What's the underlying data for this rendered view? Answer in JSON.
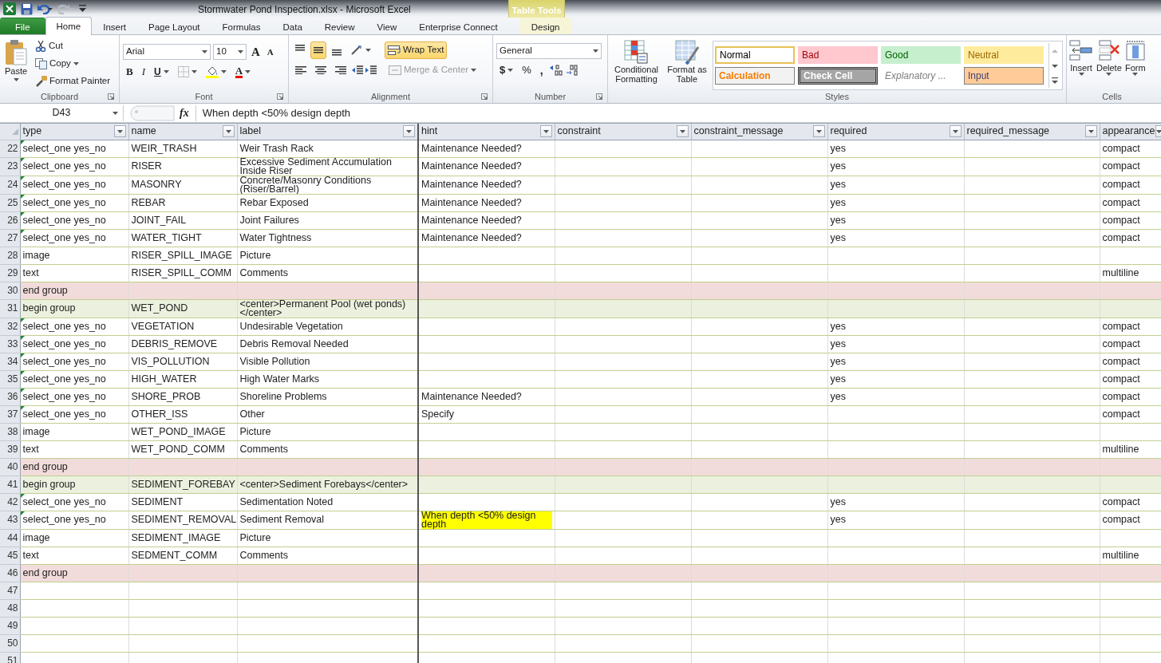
{
  "window": {
    "title": "Stormwater Pond Inspection.xlsx  -  Microsoft Excel"
  },
  "contextual_group": {
    "label": "Table Tools"
  },
  "tabs": [
    {
      "label": "File",
      "kind": "file",
      "selected": false
    },
    {
      "label": "Home",
      "kind": "tab",
      "selected": true
    },
    {
      "label": "Insert",
      "kind": "tab",
      "selected": false
    },
    {
      "label": "Page Layout",
      "kind": "tab",
      "selected": false
    },
    {
      "label": "Formulas",
      "kind": "tab",
      "selected": false
    },
    {
      "label": "Data",
      "kind": "tab",
      "selected": false
    },
    {
      "label": "Review",
      "kind": "tab",
      "selected": false
    },
    {
      "label": "View",
      "kind": "tab",
      "selected": false
    },
    {
      "label": "Enterprise Connect",
      "kind": "tab",
      "selected": false
    },
    {
      "label": "Design",
      "kind": "context",
      "selected": false
    }
  ],
  "clipboard": {
    "label": "Clipboard",
    "paste": "Paste",
    "cut": "Cut",
    "copy": "Copy",
    "format_painter": "Format Painter"
  },
  "font": {
    "label": "Font",
    "font_name": "Arial",
    "font_size": "10",
    "grow": "A",
    "shrink": "A",
    "bold": "B",
    "italic": "I",
    "underline": "U",
    "font_color": "A"
  },
  "alignment": {
    "label": "Alignment",
    "vertical": [
      {
        "kind": "top",
        "on": false
      },
      {
        "kind": "middle",
        "on": true
      },
      {
        "kind": "bottom",
        "on": false
      }
    ],
    "horizontal": [
      {
        "kind": "left",
        "on": false
      },
      {
        "kind": "center",
        "on": false
      },
      {
        "kind": "right",
        "on": false
      }
    ],
    "wrap_text": {
      "label": "Wrap Text",
      "on": true
    },
    "merge_center": {
      "label": "Merge & Center",
      "disabled": true
    }
  },
  "number": {
    "label": "Number",
    "format": "General",
    "currency": "$",
    "percent": "%",
    "comma": ","
  },
  "styles": {
    "label": "Styles",
    "conditional_formatting": "Conditional Formatting",
    "format_as_table": "Format as Table",
    "gallery": [
      {
        "label": "Normal",
        "kind": "normal",
        "selected": true
      },
      {
        "label": "Bad",
        "kind": "bad",
        "selected": false
      },
      {
        "label": "Good",
        "kind": "good",
        "selected": false
      },
      {
        "label": "Neutral",
        "kind": "neutral",
        "selected": false
      },
      {
        "label": "Calculation",
        "kind": "calculation",
        "selected": false
      },
      {
        "label": "Check Cell",
        "kind": "check",
        "selected": false
      },
      {
        "label": "Explanatory ...",
        "kind": "explanatory",
        "selected": false
      },
      {
        "label": "Input",
        "kind": "input",
        "selected": false
      }
    ]
  },
  "cells_group": {
    "label": "Cells",
    "insert": "Insert",
    "delete": "Delete",
    "format": "Form"
  },
  "formula_bar": {
    "name_box": "D43",
    "function_label": "fx",
    "formula": "When depth <50% design depth"
  },
  "table": {
    "columns": [
      "type",
      "name",
      "label",
      "hint",
      "constraint",
      "constraint_message",
      "required",
      "required_message",
      "appearance"
    ],
    "rows": [
      {
        "number": "22",
        "kind": "question",
        "flag": true,
        "highlighted": false,
        "cells": [
          "select_one yes_no",
          "WEIR_TRASH",
          "Weir Trash Rack",
          "Maintenance Needed?",
          null,
          null,
          "yes",
          null,
          "compact"
        ]
      },
      {
        "number": "23",
        "kind": "question",
        "flag": true,
        "highlighted": false,
        "cells": [
          "select_one yes_no",
          "RISER",
          "Excessive Sediment Accumulation Inside Riser",
          "Maintenance Needed?",
          null,
          null,
          "yes",
          null,
          "compact"
        ]
      },
      {
        "number": "24",
        "kind": "question",
        "flag": true,
        "highlighted": false,
        "cells": [
          "select_one yes_no",
          "MASONRY",
          "Concrete/Masonry Conditions (Riser/Barrel)",
          "Maintenance Needed?",
          null,
          null,
          "yes",
          null,
          "compact"
        ]
      },
      {
        "number": "25",
        "kind": "question",
        "flag": true,
        "highlighted": false,
        "cells": [
          "select_one yes_no",
          "REBAR",
          "Rebar Exposed",
          "Maintenance Needed?",
          null,
          null,
          "yes",
          null,
          "compact"
        ]
      },
      {
        "number": "26",
        "kind": "question",
        "flag": true,
        "highlighted": false,
        "cells": [
          "select_one yes_no",
          "JOINT_FAIL",
          "Joint Failures",
          "Maintenance Needed?",
          null,
          null,
          "yes",
          null,
          "compact"
        ]
      },
      {
        "number": "27",
        "kind": "question",
        "flag": true,
        "highlighted": false,
        "cells": [
          "select_one yes_no",
          "WATER_TIGHT",
          "Water Tightness",
          "Maintenance Needed?",
          null,
          null,
          "yes",
          null,
          "compact"
        ]
      },
      {
        "number": "28",
        "kind": "question",
        "flag": false,
        "highlighted": false,
        "cells": [
          "image",
          "RISER_SPILL_IMAGE",
          "Picture",
          null,
          null,
          null,
          null,
          null,
          null
        ]
      },
      {
        "number": "29",
        "kind": "question",
        "flag": false,
        "highlighted": false,
        "cells": [
          "text",
          "RISER_SPILL_COMM",
          "Comments",
          null,
          null,
          null,
          null,
          null,
          "multiline"
        ]
      },
      {
        "number": "30",
        "kind": "end_group",
        "flag": false,
        "highlighted": false,
        "cells": [
          "end group",
          null,
          null,
          null,
          null,
          null,
          null,
          null,
          null
        ]
      },
      {
        "number": "31",
        "kind": "begin_group",
        "flag": false,
        "highlighted": false,
        "cells": [
          "begin group",
          "WET_POND",
          "<center>Permanent Pool (wet ponds)</center>",
          null,
          null,
          null,
          null,
          null,
          null
        ]
      },
      {
        "number": "32",
        "kind": "question",
        "flag": true,
        "highlighted": false,
        "cells": [
          "select_one yes_no",
          "VEGETATION",
          "Undesirable Vegetation",
          null,
          null,
          null,
          "yes",
          null,
          "compact"
        ]
      },
      {
        "number": "33",
        "kind": "question",
        "flag": true,
        "highlighted": false,
        "cells": [
          "select_one yes_no",
          "DEBRIS_REMOVE",
          "Debris Removal Needed",
          null,
          null,
          null,
          "yes",
          null,
          "compact"
        ]
      },
      {
        "number": "34",
        "kind": "question",
        "flag": true,
        "highlighted": false,
        "cells": [
          "select_one yes_no",
          "VIS_POLLUTION",
          "Visible Pollution",
          null,
          null,
          null,
          "yes",
          null,
          "compact"
        ]
      },
      {
        "number": "35",
        "kind": "question",
        "flag": true,
        "highlighted": false,
        "cells": [
          "select_one yes_no",
          "HIGH_WATER",
          "High Water Marks",
          null,
          null,
          null,
          "yes",
          null,
          "compact"
        ]
      },
      {
        "number": "36",
        "kind": "question",
        "flag": true,
        "highlighted": false,
        "cells": [
          "select_one yes_no",
          "SHORE_PROB",
          "Shoreline Problems",
          "Maintenance Needed?",
          null,
          null,
          "yes",
          null,
          "compact"
        ]
      },
      {
        "number": "37",
        "kind": "question",
        "flag": true,
        "highlighted": false,
        "cells": [
          "select_one yes_no",
          "OTHER_ISS",
          "Other",
          "Specify",
          null,
          null,
          null,
          null,
          "compact"
        ]
      },
      {
        "number": "38",
        "kind": "question",
        "flag": false,
        "highlighted": false,
        "cells": [
          "image",
          "WET_POND_IMAGE",
          "Picture",
          null,
          null,
          null,
          null,
          null,
          null
        ]
      },
      {
        "number": "39",
        "kind": "question",
        "flag": false,
        "highlighted": false,
        "cells": [
          "text",
          "WET_POND_COMM",
          "Comments",
          null,
          null,
          null,
          null,
          null,
          "multiline"
        ]
      },
      {
        "number": "40",
        "kind": "end_group",
        "flag": false,
        "highlighted": false,
        "cells": [
          "end group",
          null,
          null,
          null,
          null,
          null,
          null,
          null,
          null
        ]
      },
      {
        "number": "41",
        "kind": "begin_group",
        "flag": false,
        "highlighted": false,
        "cells": [
          "begin group",
          "SEDIMENT_FOREBAY",
          "<center>Sediment Forebays</center>",
          null,
          null,
          null,
          null,
          null,
          null
        ]
      },
      {
        "number": "42",
        "kind": "question",
        "flag": true,
        "highlighted": false,
        "cells": [
          "select_one yes_no",
          "SEDIMENT",
          "Sedimentation Noted",
          null,
          null,
          null,
          "yes",
          null,
          "compact"
        ]
      },
      {
        "number": "43",
        "kind": "question",
        "flag": true,
        "highlighted": true,
        "cells": [
          "select_one yes_no",
          "SEDIMENT_REMOVAL",
          "Sediment Removal",
          "When depth <50% design depth",
          null,
          null,
          "yes",
          null,
          "compact"
        ]
      },
      {
        "number": "44",
        "kind": "question",
        "flag": false,
        "highlighted": false,
        "cells": [
          "image",
          "SEDIMENT_IMAGE",
          "Picture",
          null,
          null,
          null,
          null,
          null,
          null
        ]
      },
      {
        "number": "45",
        "kind": "question",
        "flag": false,
        "highlighted": false,
        "cells": [
          "text",
          "SEDMENT_COMM",
          "Comments",
          null,
          null,
          null,
          null,
          null,
          "multiline"
        ]
      },
      {
        "number": "46",
        "kind": "end_group",
        "flag": false,
        "highlighted": false,
        "cells": [
          "end group",
          null,
          null,
          null,
          null,
          null,
          null,
          null,
          null
        ]
      },
      {
        "number": "47",
        "kind": "empty",
        "flag": false,
        "highlighted": false
      },
      {
        "number": "48",
        "kind": "empty",
        "flag": false,
        "highlighted": false
      },
      {
        "number": "49",
        "kind": "empty",
        "flag": false,
        "highlighted": false
      },
      {
        "number": "50",
        "kind": "empty",
        "flag": false,
        "highlighted": false
      },
      {
        "number": "51",
        "kind": "empty",
        "flag": false,
        "highlighted": false
      }
    ]
  }
}
